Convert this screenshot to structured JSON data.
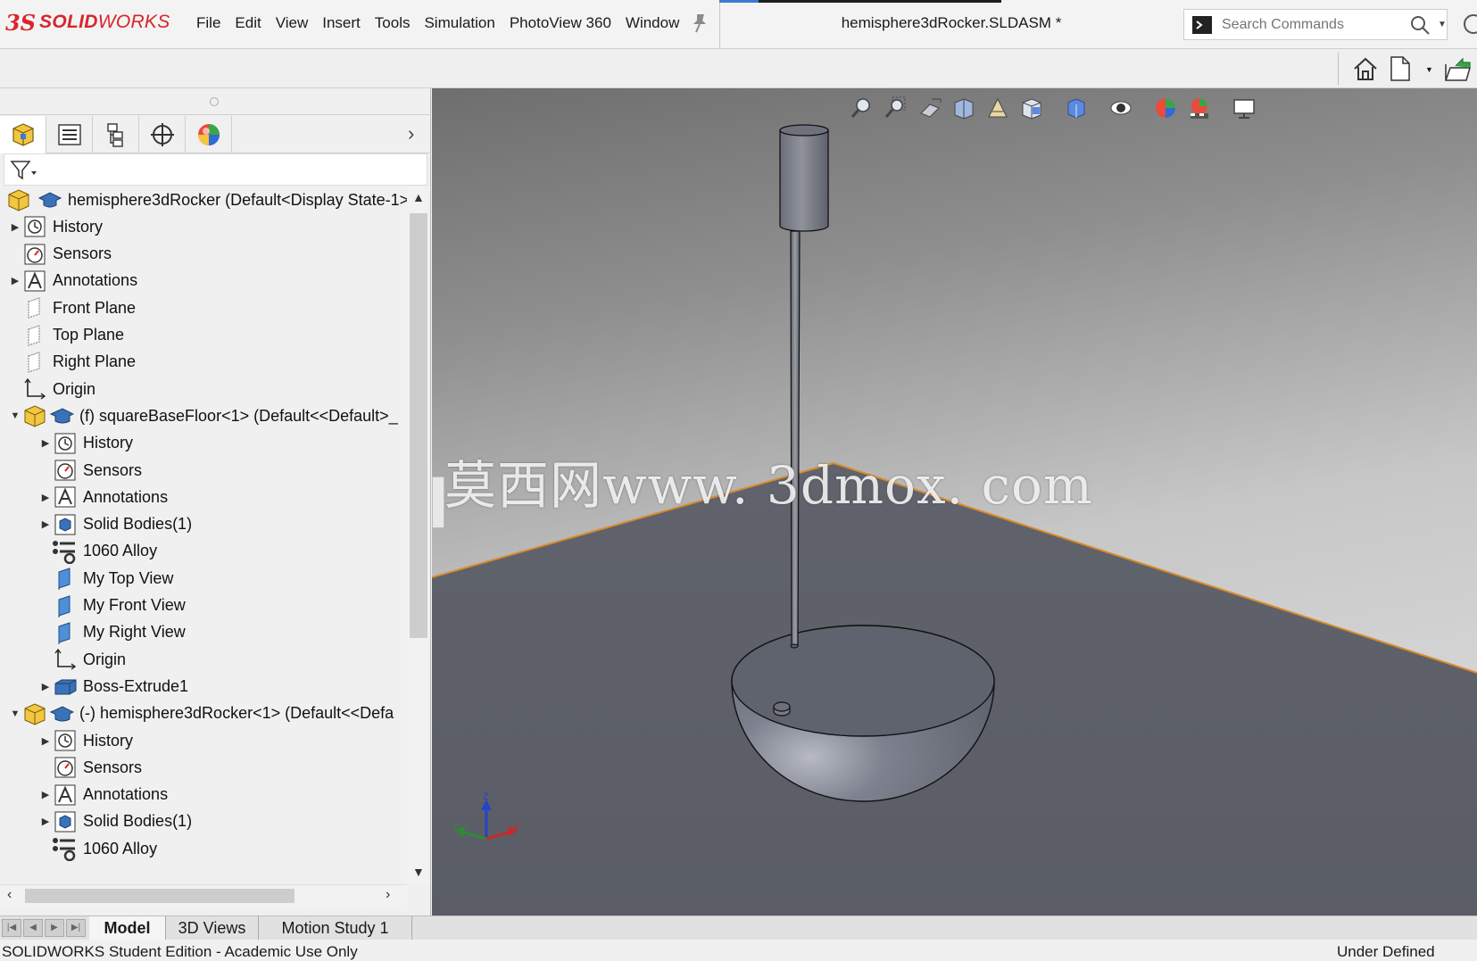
{
  "app": {
    "logo_ds": "3S",
    "logo_text_bold": "SOLID",
    "logo_text": "WORKS",
    "document_title": "hemisphere3dRocker.SLDASM *"
  },
  "menu": [
    "File",
    "Edit",
    "View",
    "Insert",
    "Tools",
    "Simulation",
    "PhotoView 360",
    "Window"
  ],
  "search": {
    "placeholder": "Search Commands"
  },
  "manager_tabs": [
    "feature-manager",
    "property-manager",
    "configuration-manager",
    "dimxpert-manager",
    "display-manager"
  ],
  "tree": [
    {
      "label": "hemisphere3dRocker  (Default<Display State-1>",
      "icon": "assembly-icon",
      "expander": "",
      "level": 0
    },
    {
      "label": "History",
      "icon": "history-icon",
      "expander": "right",
      "level": 1
    },
    {
      "label": "Sensors",
      "icon": "sensors-icon",
      "expander": "",
      "level": 1
    },
    {
      "label": "Annotations",
      "icon": "annotations-icon",
      "expander": "right",
      "level": 1
    },
    {
      "label": "Front Plane",
      "icon": "plane-icon",
      "expander": "",
      "level": 1
    },
    {
      "label": "Top Plane",
      "icon": "plane-icon",
      "expander": "",
      "level": 1
    },
    {
      "label": "Right Plane",
      "icon": "plane-icon",
      "expander": "",
      "level": 1
    },
    {
      "label": "Origin",
      "icon": "origin-icon",
      "expander": "",
      "level": 1
    },
    {
      "label": "(f) squareBaseFloor<1> (Default<<Default>_",
      "icon": "part-icon",
      "expander": "down",
      "level": 1
    },
    {
      "label": "History",
      "icon": "history-icon",
      "expander": "right",
      "level": 2
    },
    {
      "label": "Sensors",
      "icon": "sensors-icon",
      "expander": "",
      "level": 2
    },
    {
      "label": "Annotations",
      "icon": "annotations-icon",
      "expander": "right",
      "level": 2
    },
    {
      "label": "Solid Bodies(1)",
      "icon": "solid-bodies-icon",
      "expander": "right",
      "level": 2
    },
    {
      "label": "1060 Alloy",
      "icon": "material-icon",
      "expander": "",
      "level": 2
    },
    {
      "label": "My Top View",
      "icon": "view-plane-icon",
      "expander": "",
      "level": 2
    },
    {
      "label": "My Front View",
      "icon": "view-plane-icon",
      "expander": "",
      "level": 2
    },
    {
      "label": "My Right View",
      "icon": "view-plane-icon",
      "expander": "",
      "level": 2
    },
    {
      "label": "Origin",
      "icon": "origin-icon",
      "expander": "",
      "level": 2
    },
    {
      "label": "Boss-Extrude1",
      "icon": "extrude-icon",
      "expander": "right",
      "level": 2
    },
    {
      "label": "(-) hemisphere3dRocker<1> (Default<<Defa",
      "icon": "part-icon",
      "expander": "down",
      "level": 1
    },
    {
      "label": "History",
      "icon": "history-icon",
      "expander": "right",
      "level": 2
    },
    {
      "label": "Sensors",
      "icon": "sensors-icon",
      "expander": "",
      "level": 2
    },
    {
      "label": "Annotations",
      "icon": "annotations-icon",
      "expander": "right",
      "level": 2
    },
    {
      "label": "Solid Bodies(1)",
      "icon": "solid-bodies-icon",
      "expander": "right",
      "level": 2
    },
    {
      "label": "1060 Alloy",
      "icon": "material-icon",
      "expander": "",
      "level": 2
    }
  ],
  "viewport": {
    "watermark": "莫西网www. 3dmox. com",
    "triad": {
      "z": "Z",
      "y": "Y",
      "x": "X"
    },
    "hud_icons": [
      "zoom-to-fit-icon",
      "zoom-to-area-icon",
      "previous-view-icon",
      "section-view-icon",
      "dynamic-annotation-icon",
      "view-orientation-icon",
      "display-style-icon",
      "hide-show-icon",
      "edit-appearance-icon",
      "apply-scene-icon",
      "view-settings-icon"
    ]
  },
  "bottom_tabs": [
    "Model",
    "3D Views",
    "Motion Study 1"
  ],
  "status": {
    "left": "SOLIDWORKS Student Edition - Academic Use Only",
    "right": "Under Defined"
  }
}
